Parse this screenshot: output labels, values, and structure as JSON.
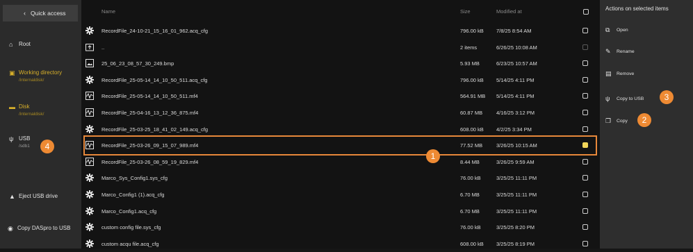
{
  "sidebar": {
    "quick_access": "Quick access",
    "root": "Root",
    "working_directory": {
      "label": "Working directory",
      "path": "/internaldisk/"
    },
    "disk": {
      "label": "Disk",
      "path": "/internaldisk/"
    },
    "usb": {
      "label": "USB",
      "path": "/sdb1"
    },
    "eject": "Eject USB drive",
    "copy_daspro": "Copy DASpro to USB",
    "badge": "4"
  },
  "table": {
    "col_name": "Name",
    "col_size": "Size",
    "col_modified": "Modified at",
    "selected_badge": "1",
    "rows": [
      {
        "name": "RecordFile_24-10-21_15_16_01_962.acq_cfg",
        "size": "796.00 kB",
        "date": "7/8/25 8:54 AM",
        "icon": "gear-icon"
      },
      {
        "name": "..",
        "size": "2 items",
        "date": "6/26/25 10:08 AM",
        "icon": "folder-up-icon"
      },
      {
        "name": "25_06_23_08_57_30_249.bmp",
        "size": "5.93 MB",
        "date": "6/23/25 10:57 AM",
        "icon": "image-icon"
      },
      {
        "name": "RecordFile_25-05-14_14_10_50_511.acq_cfg",
        "size": "796.00 kB",
        "date": "5/14/25 4:11 PM",
        "icon": "gear-icon"
      },
      {
        "name": "RecordFile_25-05-14_14_10_50_511.mf4",
        "size": "564.91 MB",
        "date": "5/14/25 4:11 PM",
        "icon": "signal-file-icon"
      },
      {
        "name": "RecordFile_25-04-16_13_12_36_875.mf4",
        "size": "60.87 MB",
        "date": "4/16/25 3:12 PM",
        "icon": "signal-file-icon"
      },
      {
        "name": "RecordFile_25-03-25_18_41_02_149.acq_cfg",
        "size": "608.00 kB",
        "date": "4/2/25 3:34 PM",
        "icon": "gear-icon"
      },
      {
        "name": "RecordFile_25-03-26_09_15_07_989.mf4",
        "size": "77.52 MB",
        "date": "3/26/25 10:15 AM",
        "icon": "signal-file-icon"
      },
      {
        "name": "RecordFile_25-03-26_08_59_19_829.mf4",
        "size": "8.44 MB",
        "date": "3/26/25 9:59 AM",
        "icon": "signal-file-icon"
      },
      {
        "name": "Marco_Sys_Config1.sys_cfg",
        "size": "76.00 kB",
        "date": "3/25/25 11:11 PM",
        "icon": "gear-icon"
      },
      {
        "name": "Marco_Config1 (1).acq_cfg",
        "size": "6.70 MB",
        "date": "3/25/25 11:11 PM",
        "icon": "gear-icon"
      },
      {
        "name": "Marco_Config1.acq_cfg",
        "size": "6.70 MB",
        "date": "3/25/25 11:11 PM",
        "icon": "gear-icon"
      },
      {
        "name": "custom config file.sys_cfg",
        "size": "76.00 kB",
        "date": "3/25/25 8:20 PM",
        "icon": "gear-icon"
      },
      {
        "name": "custom acqu file.acq_cfg",
        "size": "608.00 kB",
        "date": "3/25/25 8:19 PM",
        "icon": "gear-icon"
      }
    ]
  },
  "actions": {
    "title": "Actions on selected items",
    "open": "Open",
    "rename": "Rename",
    "remove": "Remove",
    "copy_to_usb": "Copy to USB",
    "copy": "Copy",
    "badge_copy_usb": "3",
    "badge_copy": "2"
  },
  "colors": {
    "accent": "#ee8a33",
    "gold": "#d8b02a",
    "checked": "#f2d65a"
  }
}
